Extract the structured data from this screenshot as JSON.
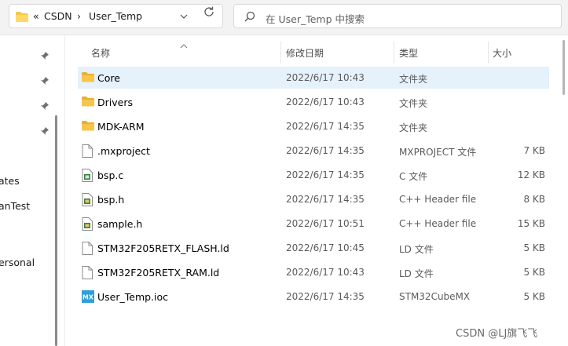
{
  "address": {
    "overflow": "«",
    "crumbs": [
      "CSDN",
      "User_Temp"
    ],
    "separator": "›"
  },
  "search": {
    "placeholder": "在 User_Temp 中搜索"
  },
  "nav": {
    "labels": [
      "ates",
      "anTest",
      "ersonal"
    ]
  },
  "columns": {
    "name": "名称",
    "date": "修改日期",
    "type": "类型",
    "size": "大小"
  },
  "files": [
    {
      "name": "Core",
      "date": "2022/6/17 10:43",
      "type": "文件夹",
      "size": "",
      "icon": "folder-icon",
      "selected": true
    },
    {
      "name": "Drivers",
      "date": "2022/6/17 10:43",
      "type": "文件夹",
      "size": "",
      "icon": "folder-icon"
    },
    {
      "name": "MDK-ARM",
      "date": "2022/6/17 14:35",
      "type": "文件夹",
      "size": "",
      "icon": "folder-icon"
    },
    {
      "name": ".mxproject",
      "date": "2022/6/17 14:35",
      "type": "MXPROJECT 文件",
      "size": "7 KB",
      "icon": "file-icon"
    },
    {
      "name": "bsp.c",
      "date": "2022/6/17 14:35",
      "type": "C 文件",
      "size": "12 KB",
      "icon": "c-source-file-icon"
    },
    {
      "name": "bsp.h",
      "date": "2022/6/17 14:35",
      "type": "C++ Header file",
      "size": "8 KB",
      "icon": "header-file-icon"
    },
    {
      "name": "sample.h",
      "date": "2022/6/17 10:51",
      "type": "C++ Header file",
      "size": "15 KB",
      "icon": "header-file-icon"
    },
    {
      "name": "STM32F205RETX_FLASH.ld",
      "date": "2022/6/17 10:45",
      "type": "LD 文件",
      "size": "5 KB",
      "icon": "file-icon"
    },
    {
      "name": "STM32F205RETX_RAM.ld",
      "date": "2022/6/17 10:43",
      "type": "LD 文件",
      "size": "5 KB",
      "icon": "file-icon"
    },
    {
      "name": "User_Temp.ioc",
      "date": "2022/6/17 14:35",
      "type": "STM32CubeMX",
      "size": "5 KB",
      "icon": "stm32cubemx-icon",
      "icon_text": "MX"
    }
  ],
  "watermark": "CSDN @LJ旗飞飞",
  "colors": {
    "folder": "#f6c64a",
    "selected_row": "#e5f1fb",
    "mx_icon": "#2f9fd8"
  }
}
